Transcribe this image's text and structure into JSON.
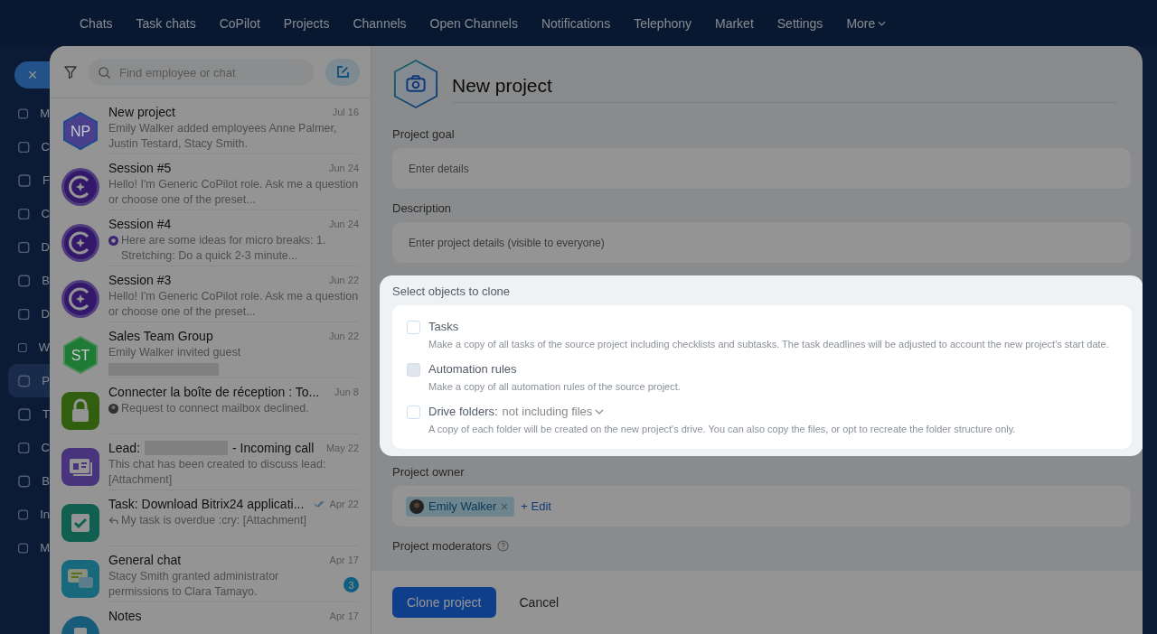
{
  "top_nav": {
    "items": [
      {
        "label": "Chats"
      },
      {
        "label": "Task chats"
      },
      {
        "label": "CoPilot"
      },
      {
        "label": "Projects"
      },
      {
        "label": "Channels"
      },
      {
        "label": "Open Channels"
      },
      {
        "label": "Notifications"
      },
      {
        "label": "Telephony"
      },
      {
        "label": "Market"
      },
      {
        "label": "Settings"
      }
    ],
    "more": "More"
  },
  "sidebar": {
    "close": "×",
    "items": [
      {
        "letter": "M",
        "selected": false
      },
      {
        "letter": "C",
        "selected": false
      },
      {
        "letter": "F",
        "selected": false
      },
      {
        "letter": "C",
        "selected": false
      },
      {
        "letter": "D",
        "selected": false
      },
      {
        "letter": "B",
        "selected": false
      },
      {
        "letter": "D",
        "selected": false
      },
      {
        "letter": "W",
        "selected": false
      },
      {
        "letter": "P",
        "selected": true
      },
      {
        "letter": "T",
        "selected": false
      },
      {
        "letter": "C",
        "selected": false
      },
      {
        "letter": "B",
        "selected": false
      },
      {
        "letter": "In",
        "selected": false
      },
      {
        "letter": "M",
        "selected": false
      }
    ]
  },
  "chat_list": {
    "search": {
      "placeholder": "Find employee or chat"
    },
    "chats": [
      {
        "title": "New project",
        "date": "Jul 16",
        "preview": "Emily Walker added employees Anne Palmer, Justin Testard, Stacy Smith.",
        "avatar": {
          "kind": "hex",
          "initials": "NP",
          "color": "#4a3f8a"
        }
      },
      {
        "title": "Session #5",
        "date": "Jun 24",
        "preview": "Hello! I'm Generic CoPilot role. Ask me a question or choose one of the preset...",
        "avatar": {
          "kind": "copilot"
        }
      },
      {
        "title": "Session #4",
        "date": "Jun 24",
        "preview": "Here are some ideas for micro breaks: 1. Stretching: Do a quick 2-3 minute...",
        "avatar": {
          "kind": "copilot"
        },
        "preview_icon": {
          "kind": "copilot"
        }
      },
      {
        "title": "Session #3",
        "date": "Jun 22",
        "preview": "Hello! I'm Generic CoPilot role. Ask me a question or choose one of the preset...",
        "avatar": {
          "kind": "copilot"
        }
      },
      {
        "title": "Sales Team Group",
        "date": "Jun 22",
        "preview": "Emily Walker invited guest",
        "avatar": {
          "kind": "hex",
          "initials": "ST",
          "color": "#1f7a35"
        },
        "redacted_line": true
      },
      {
        "title": "Connecter la boîte de réception : To...",
        "date": "Jun 8",
        "preview": "Request to connect mailbox declined.",
        "avatar": {
          "kind": "lock"
        },
        "preview_icon": {
          "kind": "person"
        }
      },
      {
        "title_start": "Lead:",
        "title": "- Incoming call",
        "date": "May 22",
        "preview": "This chat has been created to discuss lead: [Attachment]",
        "avatar": {
          "kind": "lead"
        },
        "redacted_title": true
      },
      {
        "title": "Task: Download Bitrix24 applicati...",
        "date": "Apr 22",
        "preview": "My task is overdue :cry: [Attachment]",
        "avatar": {
          "kind": "task"
        },
        "read": true,
        "preview_icon": {
          "kind": "reply"
        }
      },
      {
        "title": "General chat",
        "date": "Apr 17",
        "preview": "Stacy Smith granted administrator permissions to Clara Tamayo.",
        "avatar": {
          "kind": "general"
        },
        "counter": "3"
      },
      {
        "title": "Notes",
        "date": "Apr 17",
        "avatar": {
          "kind": "notes"
        }
      }
    ]
  },
  "form": {
    "title": "New project",
    "goal": {
      "label": "Project goal",
      "placeholder": "Enter details"
    },
    "description": {
      "label": "Description",
      "placeholder": "Enter project details (visible to everyone)"
    },
    "clone": {
      "title": "Select objects to clone",
      "options": [
        {
          "label": "Tasks",
          "checked": false,
          "disabled": false,
          "hint": "Make a copy of all tasks of the source project including checklists and subtasks. The task deadlines will be adjusted to account the new project's start date."
        },
        {
          "label": "Automation rules",
          "checked": false,
          "disabled": true,
          "hint": "Make a copy of all automation rules of the source project."
        },
        {
          "label": "Drive folders:",
          "dropdown": "not including files",
          "checked": false,
          "disabled": false,
          "hint": "A copy of each folder will be created on the new project's drive. You can also copy the files, or opt to recreate the folder structure only."
        }
      ]
    },
    "owner": {
      "label": "Project owner",
      "person": "Emily Walker",
      "edit": "+ Edit"
    },
    "moderators": {
      "label": "Project moderators"
    },
    "buttons": {
      "primary": "Clone project",
      "cancel": "Cancel"
    }
  }
}
